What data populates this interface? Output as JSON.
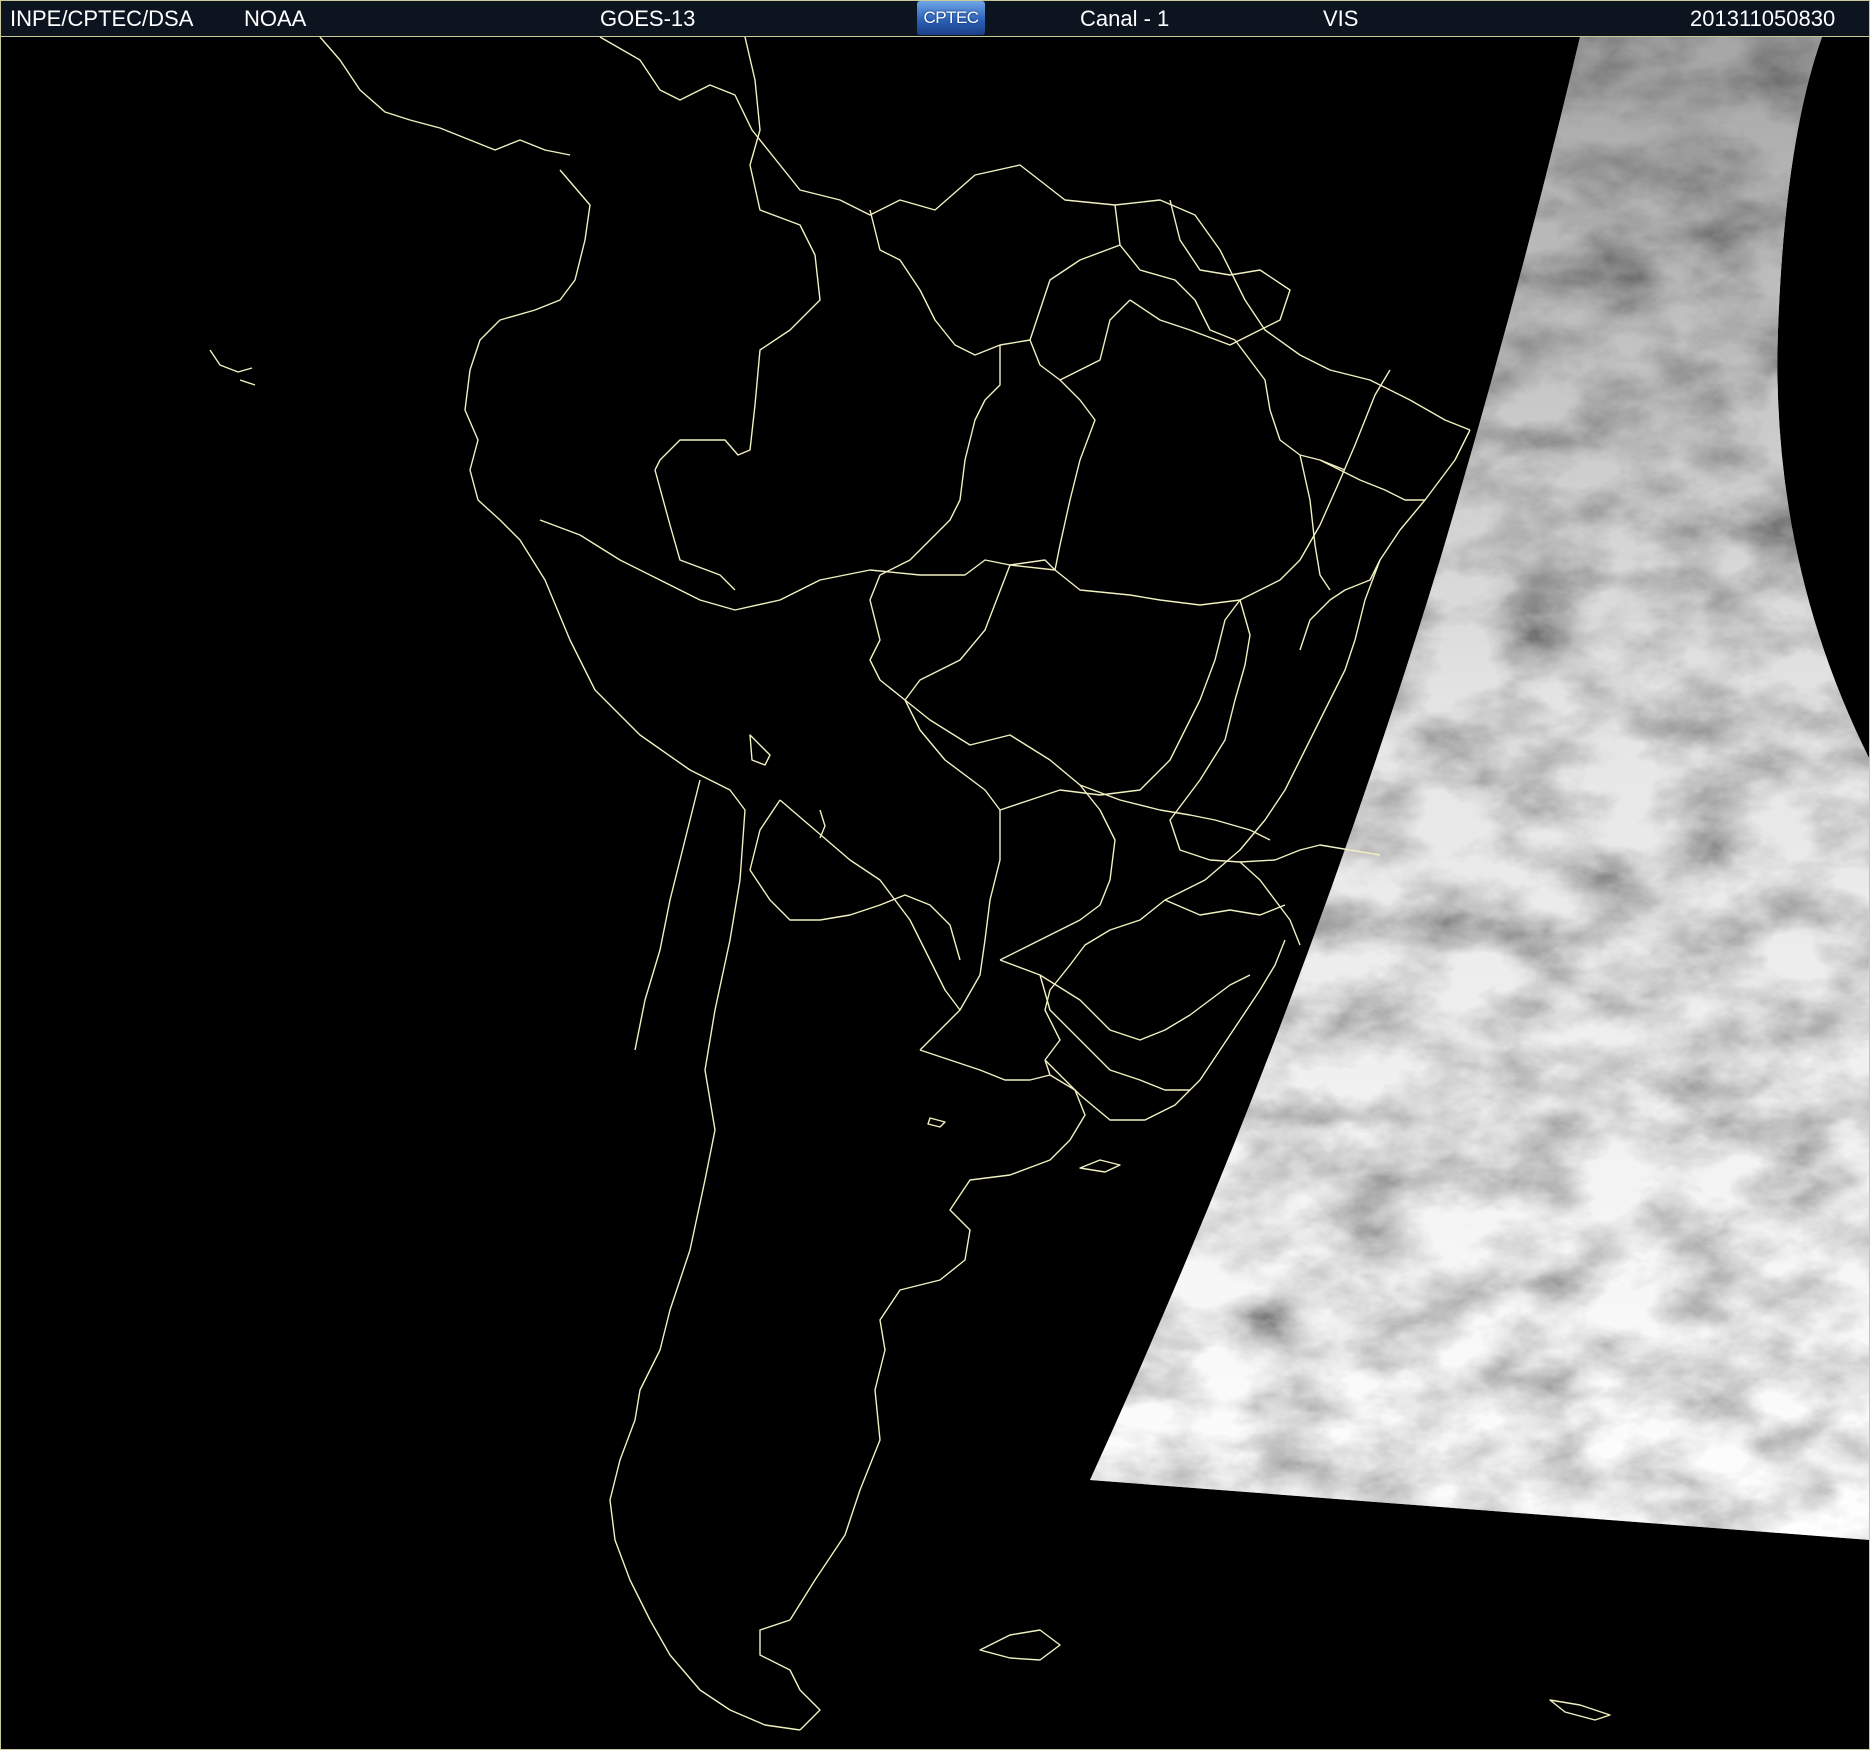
{
  "header": {
    "institution": "INPE/CPTEC/DSA",
    "agency": "NOAA",
    "satellite": "GOES-13",
    "logo_text": "CPTEC",
    "channel": "Canal - 1",
    "band": "VIS",
    "timestamp": "201311050830"
  },
  "image": {
    "background_color": "#000000",
    "boundary_color": "#f0f0c0",
    "header_color": "#0c1420"
  }
}
